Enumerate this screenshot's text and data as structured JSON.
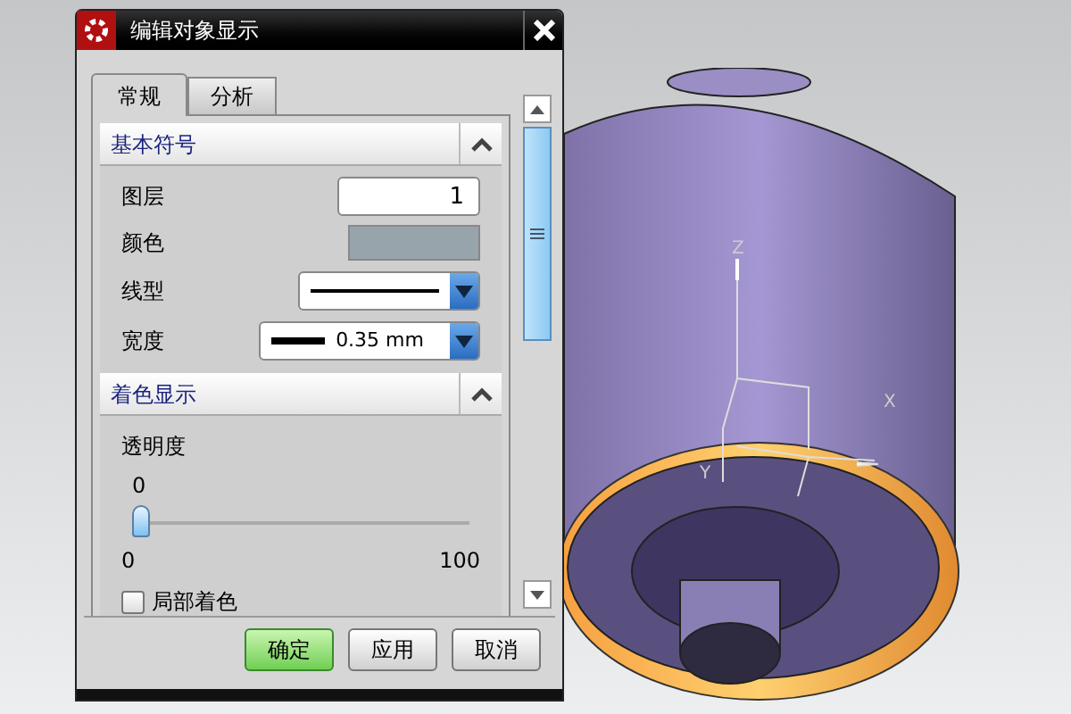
{
  "window": {
    "title": "编辑对象显示"
  },
  "tabs": [
    {
      "label": "常规",
      "selected": true
    },
    {
      "label": "分析",
      "selected": false
    }
  ],
  "sections": [
    {
      "title": "基本符号",
      "expanded": true,
      "fields": [
        {
          "kind": "number",
          "label": "图层",
          "value": "1"
        },
        {
          "kind": "color",
          "label": "颜色",
          "color": "#98a4ab"
        },
        {
          "kind": "linetype",
          "label": "线型"
        },
        {
          "kind": "width",
          "label": "宽度",
          "value": "0.35 mm"
        }
      ]
    },
    {
      "title": "着色显示",
      "expanded": true,
      "fields": [
        {
          "kind": "slider",
          "label": "透明度",
          "reading": "0",
          "level": 0,
          "min": "0",
          "max": "100"
        },
        {
          "kind": "checkbox",
          "label": "局部着色",
          "checked": false
        }
      ]
    }
  ],
  "buttons": [
    {
      "label": "确定",
      "default": true
    },
    {
      "label": "应用",
      "default": false
    },
    {
      "label": "取消",
      "default": false
    }
  ],
  "viewport": {
    "axes": [
      "Z",
      "X",
      "Y"
    ]
  }
}
